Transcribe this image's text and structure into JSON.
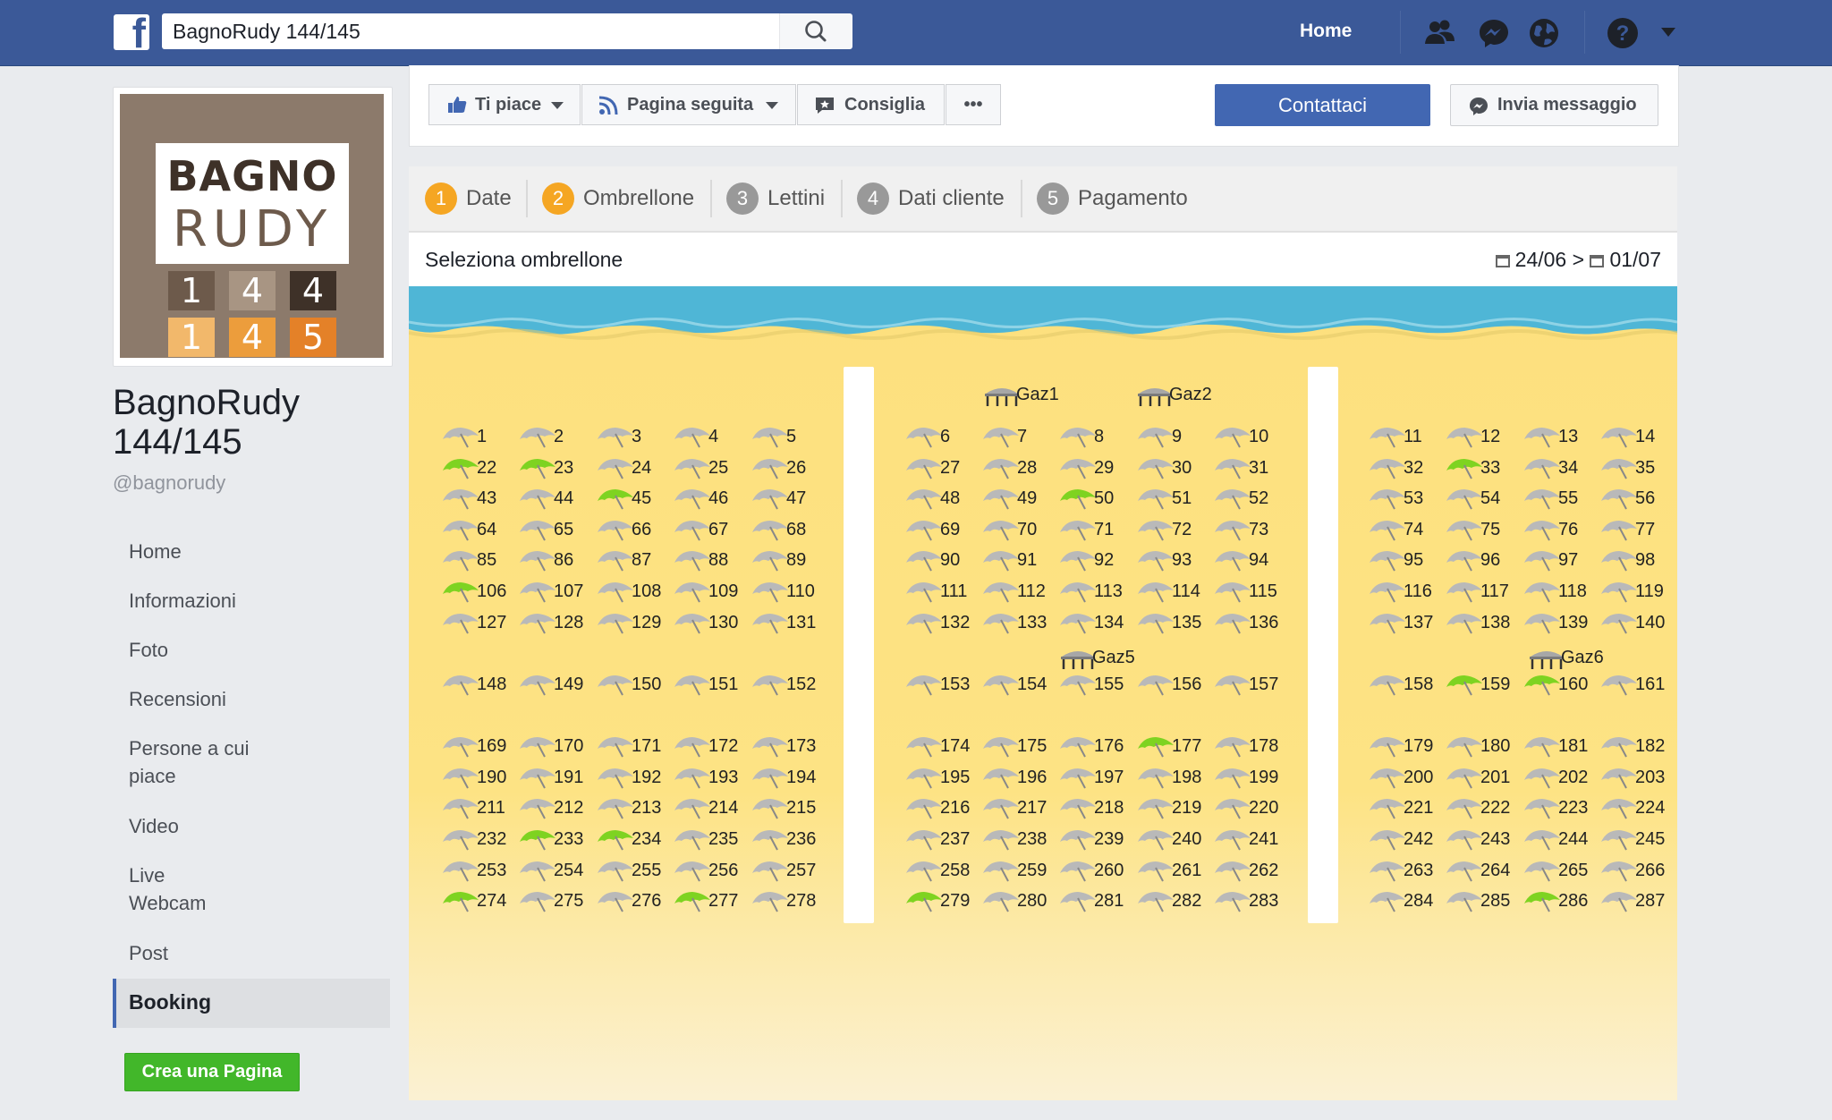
{
  "header": {
    "search_value": "BagnoRudy 144/145",
    "nav_home": "Home",
    "brand_color": "#3b5998"
  },
  "page": {
    "logo": {
      "line1": "BAGNO",
      "line2": "RUDY",
      "digits": [
        "1",
        "4",
        "4",
        "1",
        "4",
        "5"
      ]
    },
    "name": "BagnoRudy 144/145",
    "handle": "@bagnorudy"
  },
  "sidebar": {
    "items": [
      {
        "label": "Home"
      },
      {
        "label": "Informazioni"
      },
      {
        "label": "Foto"
      },
      {
        "label": "Recensioni"
      },
      {
        "label": "Persone a cui piace"
      },
      {
        "label": "Video"
      },
      {
        "label": "Live Webcam"
      },
      {
        "label": "Post"
      },
      {
        "label": "Booking",
        "active": true
      }
    ],
    "create_page": "Crea una Pagina"
  },
  "actions": {
    "like": "Ti piace",
    "follow": "Pagina seguita",
    "recommend": "Consiglia",
    "more": "•••",
    "contact": "Contattaci",
    "message": "Invia messaggio"
  },
  "booking": {
    "steps": [
      {
        "num": "1",
        "label": "Date",
        "color": "#f5a623"
      },
      {
        "num": "2",
        "label": "Ombrellone",
        "color": "#f5a623"
      },
      {
        "num": "3",
        "label": "Lettini",
        "color": "#999999"
      },
      {
        "num": "4",
        "label": "Dati cliente",
        "color": "#999999"
      },
      {
        "num": "5",
        "label": "Pagamento",
        "color": "#999999"
      }
    ],
    "select_title": "Seleziona ombrellone",
    "date_from": "24/06",
    "date_sep": ">",
    "date_to": "01/07",
    "available_numbers": [
      22,
      23,
      45,
      106,
      50,
      33,
      159,
      160,
      177,
      233,
      234,
      274,
      277,
      279,
      286
    ],
    "gazebos": [
      "Gaz1",
      "Gaz2",
      "Gaz5",
      "Gaz6"
    ],
    "colors": {
      "sand": "#fde07e",
      "sea": "#4fb6d6",
      "available": "#7ed321",
      "unavailable": "#b9b9b9"
    }
  }
}
